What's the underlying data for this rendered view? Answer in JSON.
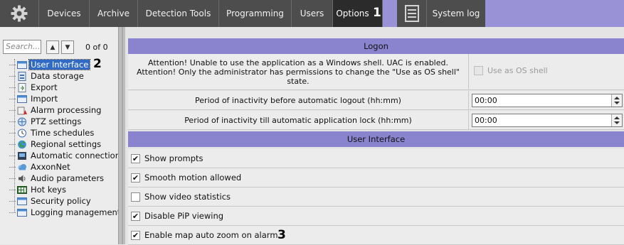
{
  "topbar": {
    "tabs": [
      {
        "label": "Devices"
      },
      {
        "label": "Archive"
      },
      {
        "label": "Detection Tools"
      },
      {
        "label": "Programming"
      },
      {
        "label": "Users"
      },
      {
        "label": "Options",
        "active": true
      },
      {
        "label": "System log"
      }
    ],
    "settings_icon": "gear-icon",
    "log_icon": "document-icon"
  },
  "callouts": {
    "c1": "1",
    "c2": "2",
    "c3": "3"
  },
  "sidebar": {
    "search_placeholder": "Search...",
    "count": "0 of 0",
    "items": [
      {
        "label": "User Interface",
        "icon": "window-icon",
        "selected": true
      },
      {
        "label": "Data storage",
        "icon": "storage-icon"
      },
      {
        "label": "Export",
        "icon": "export-icon"
      },
      {
        "label": "Import",
        "icon": "import-icon"
      },
      {
        "label": "Alarm processing",
        "icon": "alarm-icon"
      },
      {
        "label": "PTZ settings",
        "icon": "ptz-icon"
      },
      {
        "label": "Time schedules",
        "icon": "clock-icon"
      },
      {
        "label": "Regional settings",
        "icon": "globe-icon"
      },
      {
        "label": "Automatic connection",
        "icon": "connection-icon"
      },
      {
        "label": "AxxonNet",
        "icon": "cloud-icon"
      },
      {
        "label": "Audio parameters",
        "icon": "audio-icon"
      },
      {
        "label": "Hot keys",
        "icon": "keyboard-icon"
      },
      {
        "label": "Security policy",
        "icon": "window-icon"
      },
      {
        "label": "Logging management",
        "icon": "window-icon"
      }
    ]
  },
  "main": {
    "logon_header": "Logon",
    "attention_line1": "Attention! Unable to use the application as a Windows shell. UAC is enabled.",
    "attention_line2": "Attention! Only the administrator has permissions to change the \"Use as OS shell\"",
    "attention_line3": "state.",
    "os_shell_label": "Use as OS shell",
    "logout_label": "Period of inactivity before automatic logout (hh:mm)",
    "logout_value": "00:00",
    "lock_label": "Period of inactivity till automatic application lock (hh:mm)",
    "lock_value": "00:00",
    "ui_header": "User Interface",
    "options": [
      {
        "label": "Show prompts",
        "checked": true
      },
      {
        "label": "Smooth motion allowed",
        "checked": true
      },
      {
        "label": "Show video statistics",
        "checked": false
      },
      {
        "label": "Disable PiP viewing",
        "checked": true
      },
      {
        "label": "Enable map auto zoom on alarm",
        "checked": true
      }
    ]
  },
  "colors": {
    "topbar_bg": "#4d4d4d",
    "accent": "#9a92d6",
    "section_header": "#8a84cf",
    "selection": "#316ac5"
  }
}
